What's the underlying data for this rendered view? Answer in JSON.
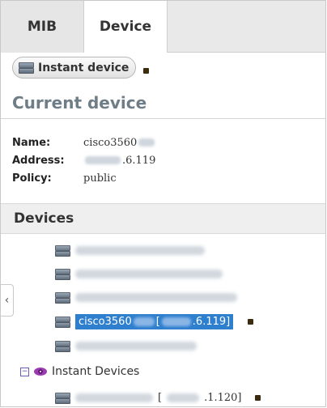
{
  "tabs": [
    {
      "label": "MIB"
    },
    {
      "label": "Device"
    }
  ],
  "toolbar": {
    "instant_device_label": "Instant device"
  },
  "current_device": {
    "title": "Current device",
    "fields": [
      {
        "label": "Name:",
        "value_prefix": "cisco3560",
        "value_suffix": ""
      },
      {
        "label": "Address:",
        "value_prefix": "",
        "value_suffix": ".6.119"
      },
      {
        "label": "Policy:",
        "value_prefix": "public",
        "value_suffix": ""
      }
    ]
  },
  "devices": {
    "title": "Devices",
    "selected": {
      "name_prefix": "cisco3560",
      "address_open": "[",
      "address_suffix": ".6.119]"
    },
    "instant_group_label": "Instant Devices",
    "instant_item": {
      "address_open": "[",
      "address_suffix": ".1.120]"
    }
  },
  "icons": {
    "collapse": "chevron-left-icon",
    "server": "server-icon",
    "group": "eye-icon",
    "expander": "minus-box-icon"
  },
  "colors": {
    "selection": "#2f7fcf",
    "section_title": "#6e7d86",
    "group_icon": "#9b3bb0"
  }
}
